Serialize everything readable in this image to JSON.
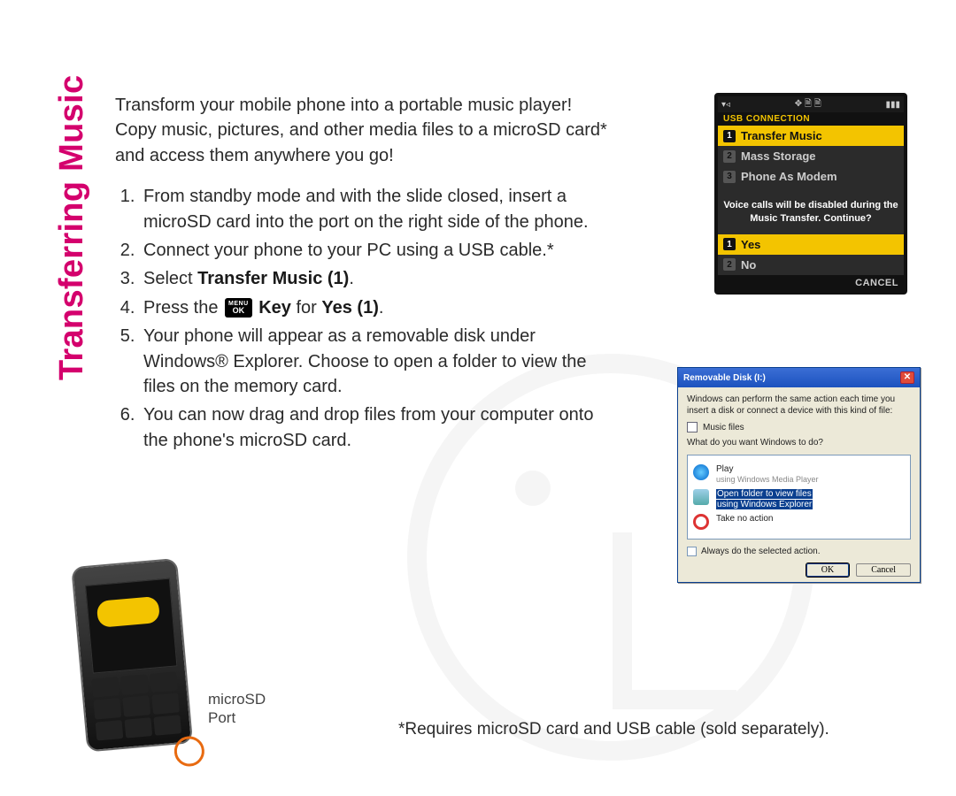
{
  "side_title": "Transferring Music",
  "intro": "Transform your mobile phone into a portable music player! Copy music, pictures, and other media files to a microSD card* and access them anywhere you go!",
  "steps": {
    "s1": "From standby mode and with the slide closed, insert a microSD card into the port on the right side of the phone.",
    "s2": "Connect your phone to your PC using a USB cable.*",
    "s3_pre": "Select ",
    "s3_bold": "Transfer Music (1)",
    "s3_post": ".",
    "s4_pre": "Press the ",
    "s4_mid": " Key",
    "s4_mid2": " for ",
    "s4_bold": "Yes (1)",
    "s4_post": ".",
    "key_menu": "MENU",
    "key_ok": "OK",
    "s5": "Your phone will appear as a removable disk under Windows® Explorer. Choose to open a folder to view the files on the memory card.",
    "s6": "You can now drag and drop files from your computer onto the phone's microSD card."
  },
  "footnote": "*Requires microSD card and USB cable (sold separately).",
  "port_label_l1": "microSD",
  "port_label_l2": "Port",
  "phone_ui": {
    "section": "USB Connection",
    "items": [
      {
        "n": "1",
        "label": "Transfer Music",
        "sel": true
      },
      {
        "n": "2",
        "label": "Mass Storage",
        "sel": false
      },
      {
        "n": "3",
        "label": "Phone As Modem",
        "sel": false
      }
    ],
    "warn": "Voice calls will be disabled during the Music Transfer. Continue?",
    "confirm": [
      {
        "n": "1",
        "label": "Yes",
        "sel": true
      },
      {
        "n": "2",
        "label": "No",
        "sel": false
      }
    ],
    "softkey": "Cancel"
  },
  "win": {
    "title": "Removable Disk (I:)",
    "msg": "Windows can perform the same action each time you insert a disk or connect a device with this kind of file:",
    "filetype": "Music files",
    "prompt": "What do you want Windows to do?",
    "opts": {
      "play": "Play",
      "play_sub": "using Windows Media Player",
      "open": "Open folder to view files",
      "open_sub": "using Windows Explorer",
      "none": "Take no action"
    },
    "always": "Always do the selected action.",
    "ok": "OK",
    "cancel": "Cancel"
  }
}
